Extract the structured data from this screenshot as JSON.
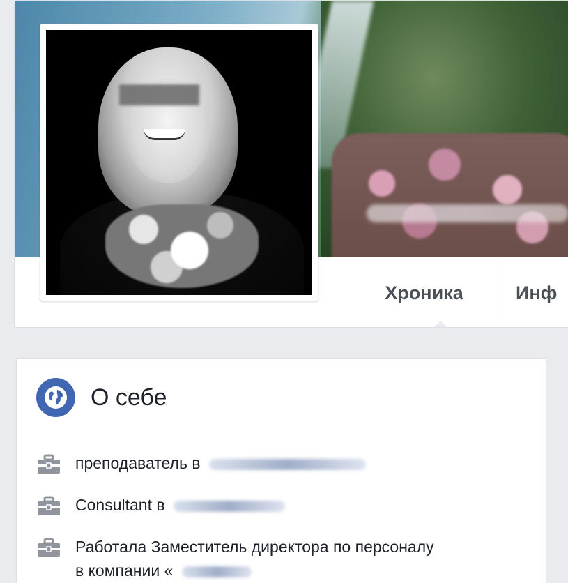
{
  "profile": {
    "tabs": [
      {
        "label": "Хроника",
        "active": true
      },
      {
        "label": "Инф"
      }
    ]
  },
  "intro": {
    "title": "О себе",
    "items": [
      {
        "icon": "briefcase-icon",
        "text": "преподаватель в"
      },
      {
        "icon": "briefcase-icon",
        "text": "Consultant в"
      },
      {
        "icon": "briefcase-icon",
        "text": "Работала Заместитель директора по персоналу в компании «"
      }
    ]
  },
  "colors": {
    "page_background": "#e9ebee",
    "accent": "#4267b2",
    "tab_text": "#4b4f56"
  }
}
